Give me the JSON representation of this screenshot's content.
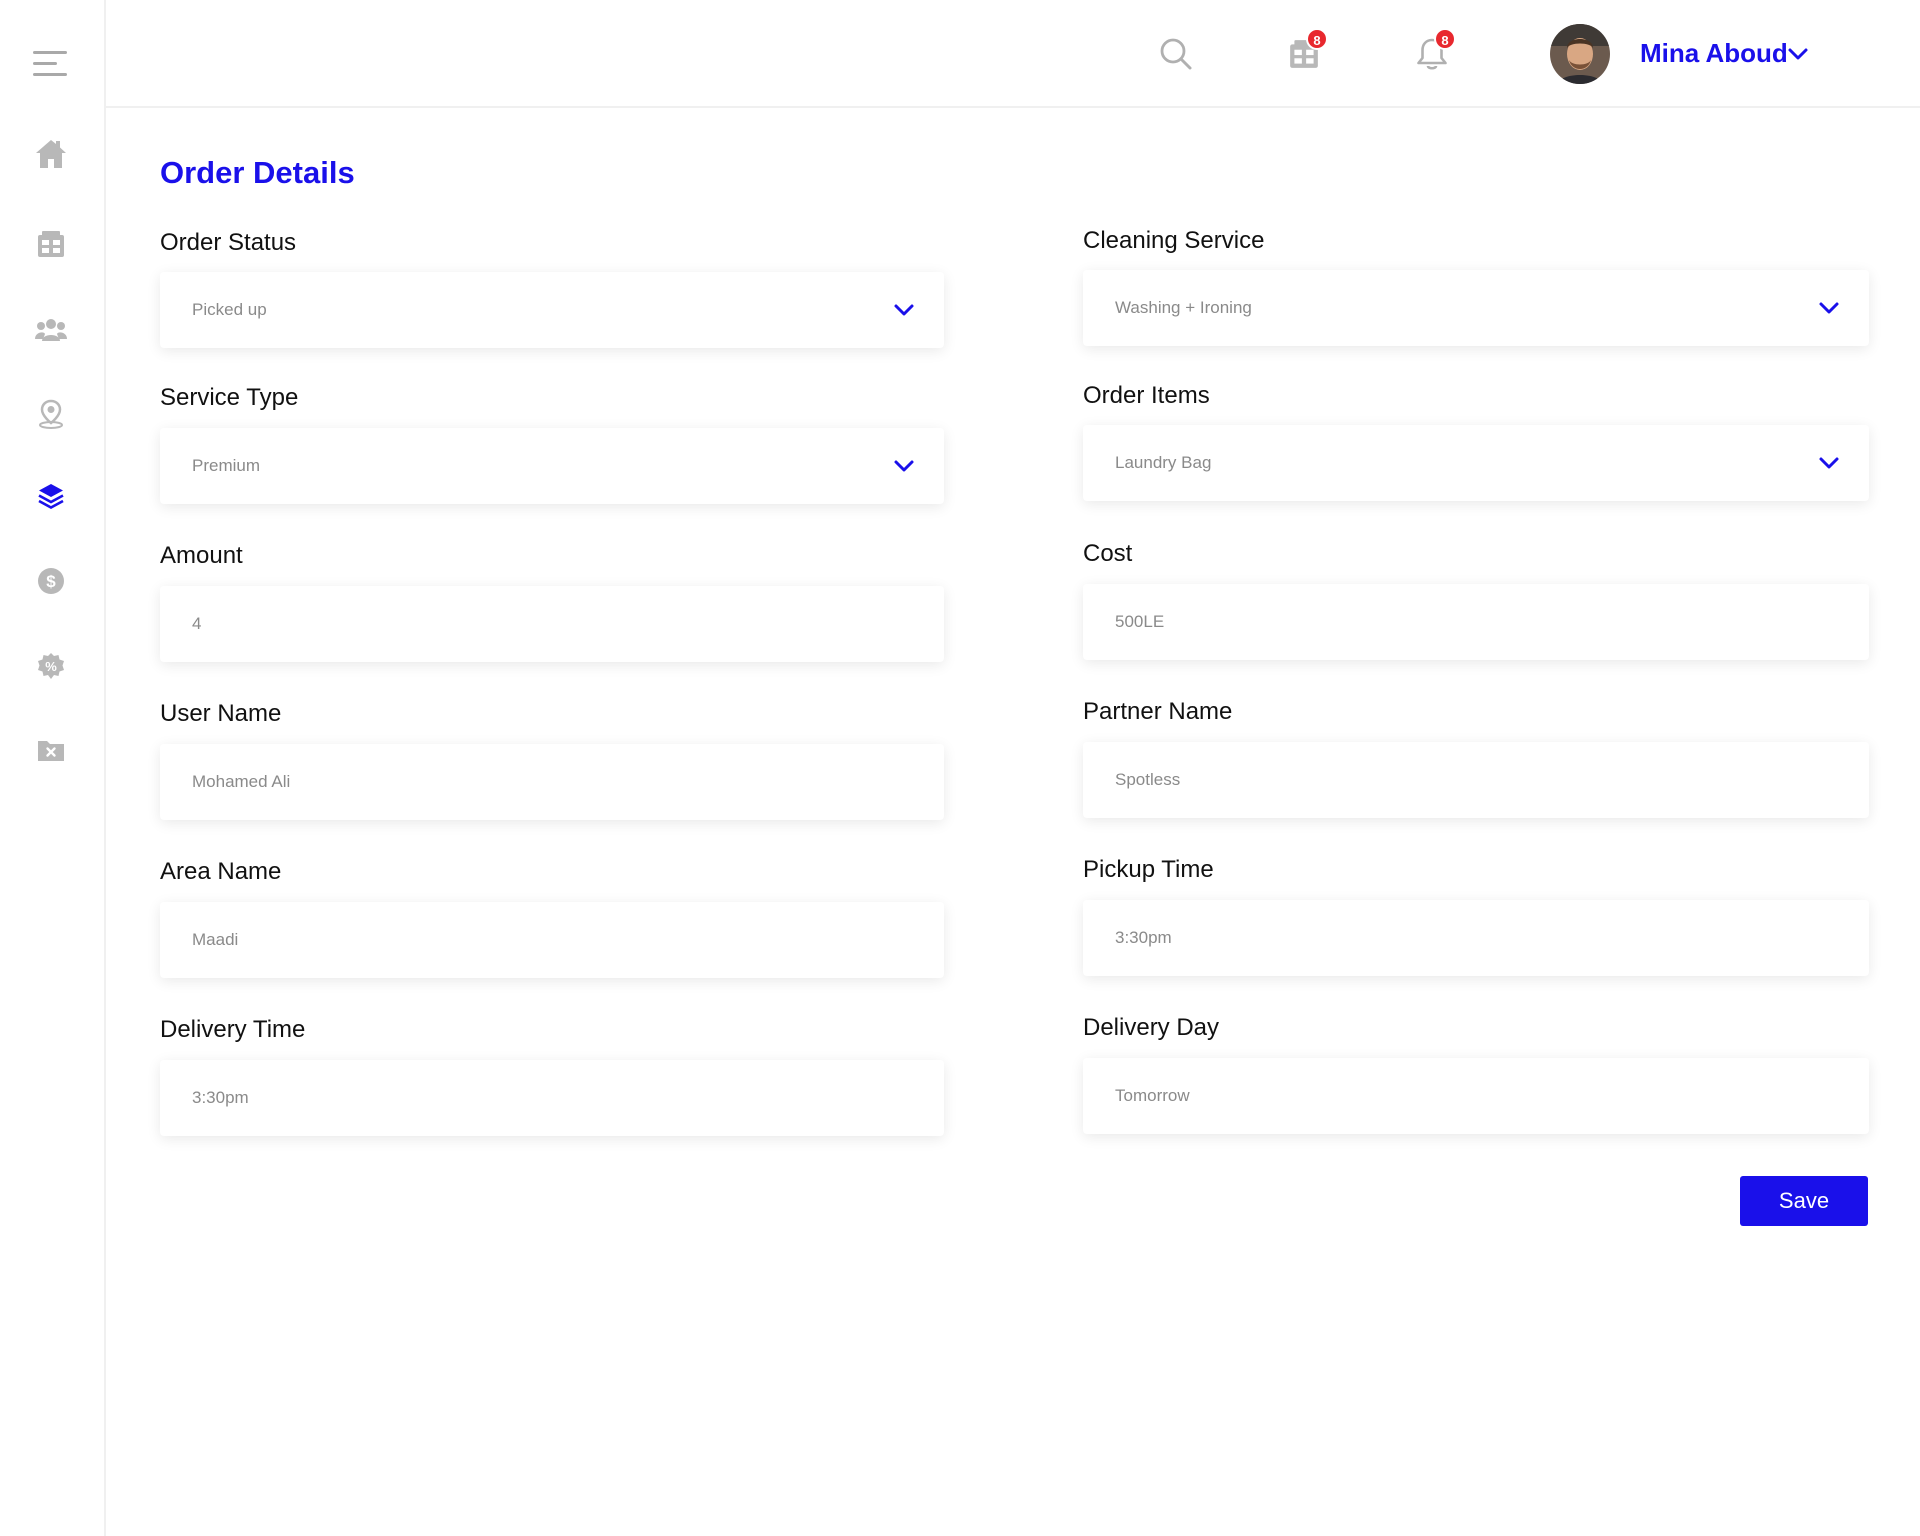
{
  "header": {
    "user_name": "Mina Aboud",
    "orders_badge": "8",
    "notifications_badge": "8"
  },
  "page": {
    "title": "Order Details"
  },
  "form": {
    "order_status": {
      "label": "Order Status",
      "value": "Picked up"
    },
    "cleaning_service": {
      "label": "Cleaning Service",
      "value": "Washing + Ironing"
    },
    "service_type": {
      "label": "Service Type",
      "value": "Premium"
    },
    "order_items": {
      "label": "Order Items",
      "value": "Laundry Bag"
    },
    "amount": {
      "label": "Amount",
      "value": "4"
    },
    "cost": {
      "label": "Cost",
      "value": "500LE"
    },
    "user_name": {
      "label": "User Name",
      "value": "Mohamed Ali"
    },
    "partner_name": {
      "label": "Partner Name",
      "value": "Spotless"
    },
    "area_name": {
      "label": "Area Name",
      "value": "Maadi"
    },
    "pickup_time": {
      "label": "Pickup Time",
      "value": "3:30pm"
    },
    "delivery_time": {
      "label": "Delivery Time",
      "value": "3:30pm"
    },
    "delivery_day": {
      "label": "Delivery Day",
      "value": "Tomorrow"
    },
    "save_label": "Save"
  },
  "colors": {
    "accent": "#1a10ea",
    "badge": "#e8282e",
    "icon_gray": "#b8b8b8"
  }
}
